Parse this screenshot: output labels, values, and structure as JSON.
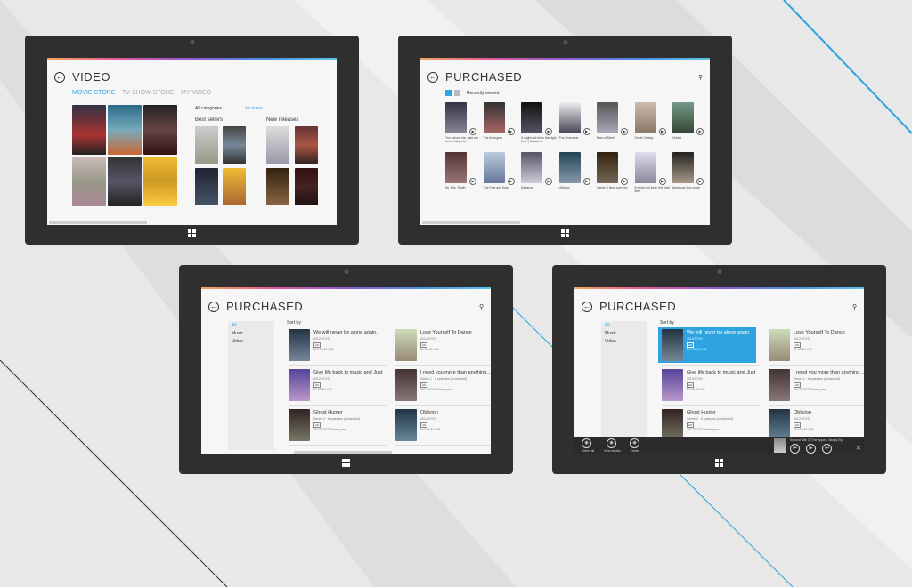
{
  "colors": {
    "accent": "#2ea3e0",
    "tablet": "#2f2f2f",
    "screen": "#f6f6f6",
    "selected": "#2ea3e0",
    "appbar": "#2b2b2b"
  },
  "screen1": {
    "title": "VIDEO",
    "tabs": [
      "MOVIE STORE",
      "TV SHOW STORE",
      "MY VIDEO"
    ],
    "categories_label": "All categories",
    "best_sellers": "Best sellers",
    "see_all": "See all items",
    "new_releases": "New releases"
  },
  "screen2": {
    "title": "PURCHASED",
    "sort_label": "Recently viewed",
    "row1": [
      "You school me, give me some things to…",
      "The Avengers",
      "It might not be in the right time | Season 1",
      "The Gravstein",
      "Man of Steel",
      "Great Gatsby",
      "Hobbit"
    ],
    "row2": [
      "Mr. Mrs. Smith",
      "The Fast and Easy",
      "Defiance",
      "Oblivion",
      "Series 3 New york city",
      "It might not be in the right time",
      "American boy mode"
    ]
  },
  "screen3": {
    "title": "PURCHASED",
    "nav": [
      "All",
      "Music",
      "Video"
    ],
    "sort_label": "Sort by",
    "items": [
      {
        "title": "We will never be alone again.",
        "sub": "2012/07/15",
        "price": "$13.99  $10.99"
      },
      {
        "title": "Lose Yourself To Dance",
        "sub": "2012/07/15",
        "price": "$1.99  $10.99"
      },
      {
        "title": "Give life back to music and Just",
        "sub": "2012/07/15",
        "price": "$2.99  $10.99"
      },
      {
        "title": "I need you more than anything…",
        "sub": "Series 1 · 6 episodes (concluded)",
        "price": "2012/07/15  Series pass"
      },
      {
        "title": "Ghost Hunter",
        "sub": "Series 2 · 6 episodes (concluded)",
        "price": "2012/07/15  Series pass"
      },
      {
        "title": "Oblivion",
        "sub": "2012/07/15",
        "price": "$13.99  $10.99"
      }
    ]
  },
  "screen4": {
    "title": "PURCHASED",
    "nav": [
      "All",
      "Music",
      "Video"
    ],
    "sort_label": "Sort by",
    "items": [
      {
        "title": "We will never be alone again.",
        "sub": "2012/07/15",
        "price": "$13.99  $10.99"
      },
      {
        "title": "Lose Yourself To Dance",
        "sub": "2012/07/15",
        "price": "$1.99  $10.99"
      },
      {
        "title": "Give life back to music and Just",
        "sub": "2012/07/15",
        "price": "$2.99  $10.99"
      },
      {
        "title": "I need you more than anything…",
        "sub": "Series 1 · 6 episodes (concluded)",
        "price": "2012/07/15  Series pass"
      },
      {
        "title": "Ghost Hunter",
        "sub": "Series 2 · 6 episodes (concluded)",
        "price": "2012/07/15  Series pass"
      },
      {
        "title": "Oblivion",
        "sub": "2012/07/15",
        "price": "$13.99  $10.99"
      }
    ],
    "appbar": [
      "Select all",
      "View details",
      "Delete"
    ],
    "now_playing": "Second Bite Of The Apple - Beady Eye"
  }
}
